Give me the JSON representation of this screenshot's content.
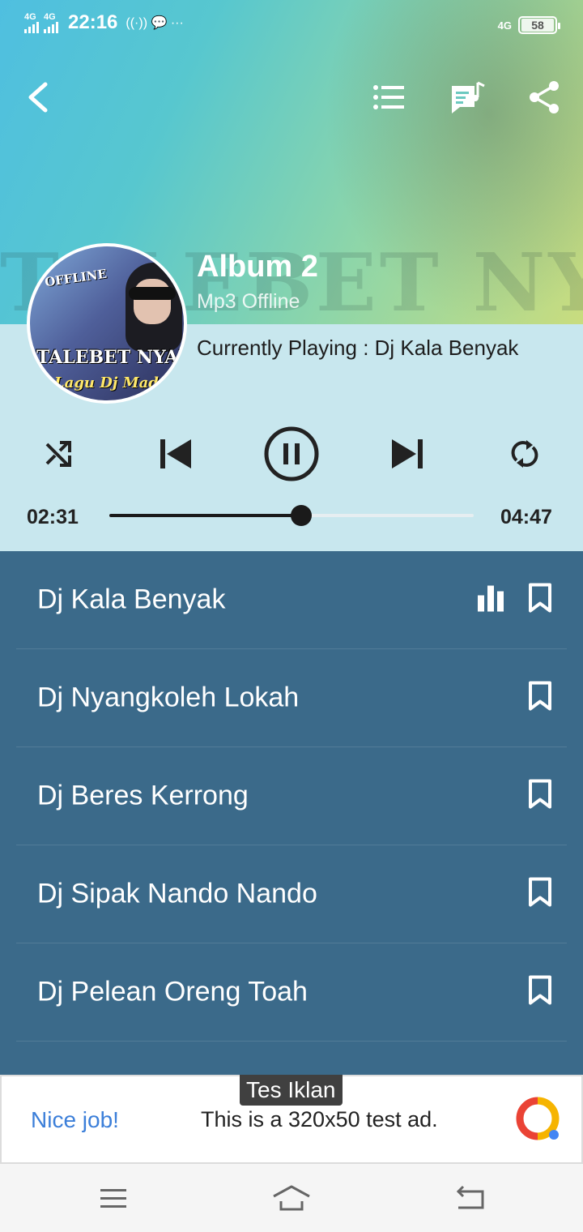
{
  "status_bar": {
    "net1": "4G",
    "net2": "4G",
    "time": "22:16",
    "extra_icons": "((·)) 💬 ···",
    "net_right": "4G",
    "battery": "58"
  },
  "app_bar": {
    "back_icon": "back-arrow-icon",
    "playlist_icon": "list-icon",
    "lyrics_icon": "music-note-message-icon",
    "share_icon": "share-icon"
  },
  "album": {
    "title": "Album 2",
    "subtitle": "Mp3 Offline",
    "now_playing_prefix": "Currently Playing : ",
    "now_playing_track": "Dj Kala Benyak",
    "cover_tag": "OFFLINE",
    "cover_text_1": "TALEBET NYAKEEH",
    "cover_text_2": "Lagu Dj Madura",
    "header_watermark": "TALEBET NYAKEEH"
  },
  "controls": {
    "shuffle_icon": "shuffle-icon",
    "prev_icon": "skip-previous-icon",
    "play_pause_icon": "pause-icon",
    "next_icon": "skip-next-icon",
    "repeat_icon": "repeat-icon"
  },
  "progress": {
    "elapsed": "02:31",
    "total": "04:47",
    "fraction": 0.526
  },
  "playlist": {
    "items": [
      {
        "title": "Dj Kala Benyak",
        "playing": true
      },
      {
        "title": "Dj Nyangkoleh Lokah",
        "playing": false
      },
      {
        "title": "Dj Beres Kerrong",
        "playing": false
      },
      {
        "title": "Dj Sipak Nando Nando",
        "playing": false
      },
      {
        "title": "Dj Pelean Oreng Toah",
        "playing": false
      }
    ]
  },
  "ad": {
    "tag": "Tes Iklan",
    "headline": "Nice job!",
    "body": "This is a 320x50 test ad."
  },
  "nav_bar": {
    "menu_icon": "menu-icon",
    "home_icon": "home-icon",
    "back_icon": "back-icon"
  },
  "colors": {
    "playlist_bg": "#3b6a8a",
    "info_bg": "#c8e7ee",
    "ad_headline": "#3c7fd9"
  }
}
